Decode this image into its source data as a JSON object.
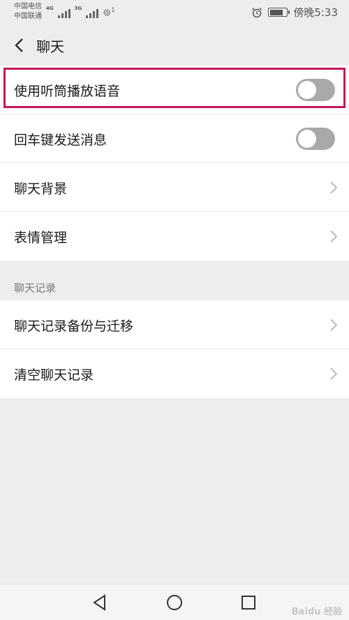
{
  "status_bar": {
    "carrier1": "中国电信",
    "carrier2": "中国联通",
    "net1": "4G",
    "net2": "3G",
    "hotspot_mark": "1",
    "time": "傍晚5:33"
  },
  "header": {
    "title": "聊天"
  },
  "group1": {
    "rows": [
      {
        "label": "使用听筒播放语音",
        "control": "toggle",
        "on": false
      },
      {
        "label": "回车键发送消息",
        "control": "toggle",
        "on": false
      },
      {
        "label": "聊天背景",
        "control": "chevron"
      },
      {
        "label": "表情管理",
        "control": "chevron"
      }
    ]
  },
  "section": {
    "label": "聊天记录"
  },
  "group2": {
    "rows": [
      {
        "label": "聊天记录备份与迁移",
        "control": "chevron"
      },
      {
        "label": "清空聊天记录",
        "control": "chevron"
      }
    ]
  },
  "highlight_color": "#c2185b",
  "watermark": "Baidu 经验"
}
